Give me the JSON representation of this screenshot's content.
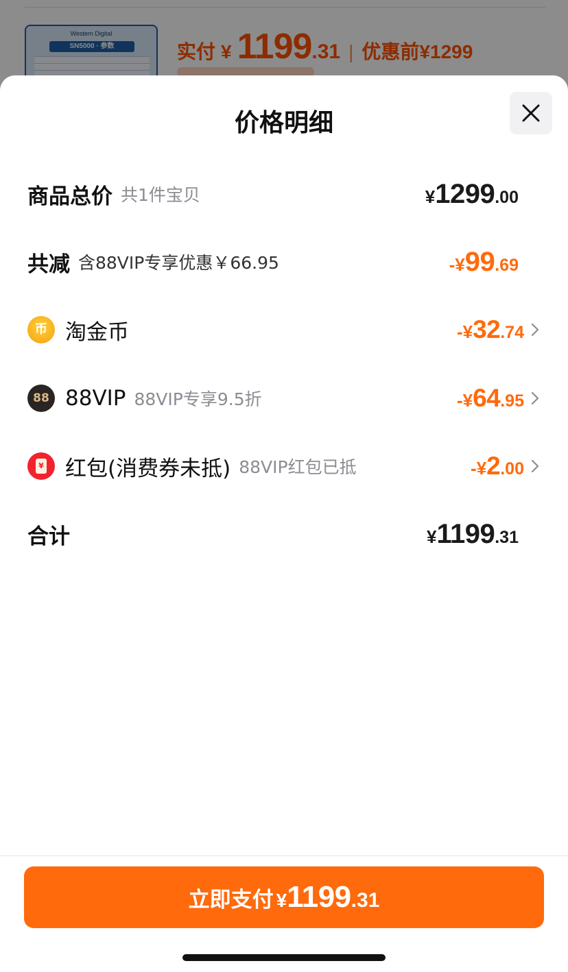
{
  "background": {
    "brand": "Western Digital",
    "model": "SN5000 · 参数",
    "price_label": "实付",
    "price_currency": "¥",
    "price_int": "1199",
    "price_dec": ".31",
    "orig_label": "优惠前",
    "orig_price": "¥1299"
  },
  "sheet": {
    "title": "价格明细",
    "close_icon": "close-icon"
  },
  "rows": {
    "total": {
      "label": "商品总价",
      "sub": "共1件宝贝",
      "currency": "¥",
      "int": "1299",
      "dec": ".00"
    },
    "discount": {
      "label": "共减",
      "sub": "含88VIP专享优惠￥66.95",
      "currency": "-¥",
      "int": "99",
      "dec": ".69"
    },
    "coin": {
      "label": "淘金币",
      "icon": "coin-icon",
      "icon_glyph": "币",
      "currency": "-¥",
      "int": "32",
      "dec": ".74"
    },
    "vip": {
      "label": "88VIP",
      "sub": "88VIP专享9.5折",
      "icon": "vip-88-icon",
      "icon_glyph": "88",
      "currency": "-¥",
      "int": "64",
      "dec": ".95"
    },
    "hongbao": {
      "label": "红包(消费券未抵)",
      "sub": "88VIP红包已抵",
      "icon": "red-envelope-icon",
      "icon_glyph": "¥",
      "currency": "-¥",
      "int": "2",
      "dec": ".00"
    },
    "sum": {
      "label": "合计",
      "currency": "¥",
      "int": "1199",
      "dec": ".31"
    }
  },
  "pay_button": {
    "label": "立即支付",
    "currency": "¥",
    "int": "1199",
    "dec": ".31"
  },
  "colors": {
    "accent": "#ff6a0c",
    "text": "#111111",
    "muted": "#8c8c93"
  }
}
